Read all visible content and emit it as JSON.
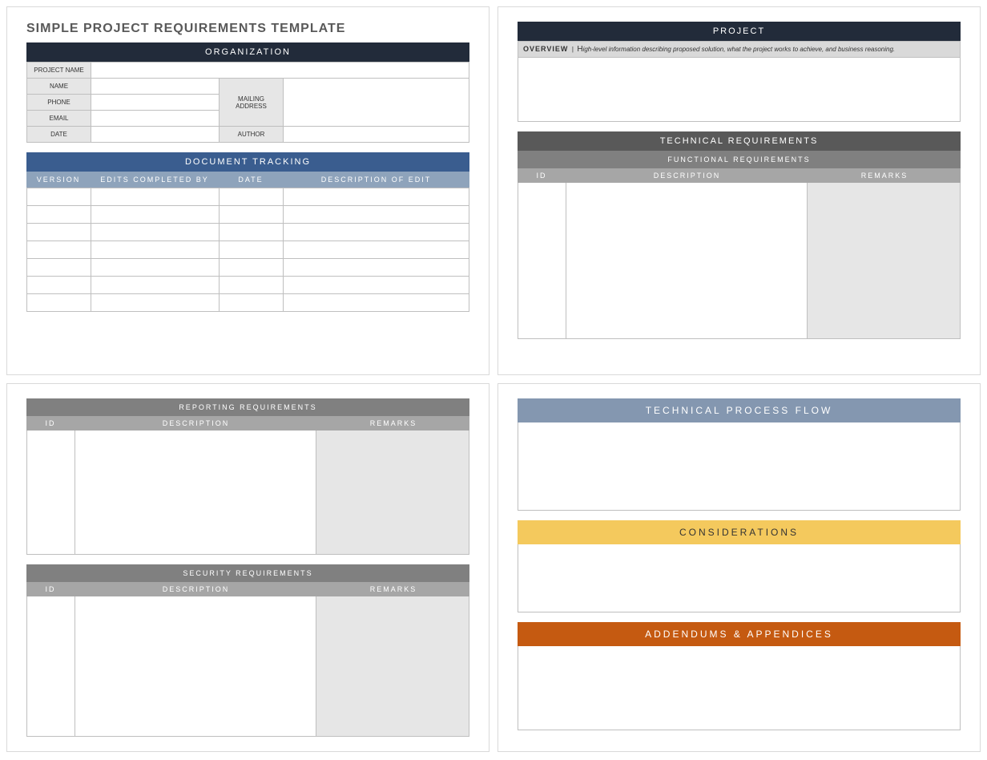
{
  "title": "SIMPLE PROJECT REQUIREMENTS TEMPLATE",
  "organization": {
    "header": "ORGANIZATION",
    "labels": {
      "project_name": "PROJECT NAME",
      "name": "NAME",
      "phone": "PHONE",
      "email": "EMAIL",
      "date": "DATE",
      "mailing_address": "MAILING ADDRESS",
      "author": "AUTHOR"
    },
    "values": {
      "project_name": "",
      "name": "",
      "phone": "",
      "email": "",
      "date": "",
      "mailing_address": "",
      "author": ""
    }
  },
  "tracking": {
    "header": "DOCUMENT TRACKING",
    "columns": [
      "VERSION",
      "EDITS COMPLETED BY",
      "DATE",
      "DESCRIPTION OF EDIT"
    ],
    "rows": [
      [
        "",
        "",
        "",
        ""
      ],
      [
        "",
        "",
        "",
        ""
      ],
      [
        "",
        "",
        "",
        ""
      ],
      [
        "",
        "",
        "",
        ""
      ],
      [
        "",
        "",
        "",
        ""
      ],
      [
        "",
        "",
        "",
        ""
      ],
      [
        "",
        "",
        "",
        ""
      ]
    ]
  },
  "project": {
    "header": "PROJECT",
    "overview_label": "OVERVIEW",
    "overview_divider": "|",
    "overview_hint_lead": "H",
    "overview_hint_rest": "igh-level information describing proposed solution, what the project works to achieve, and business reasoning."
  },
  "tech_req": {
    "header": "TECHNICAL REQUIREMENTS",
    "functional": {
      "header": "FUNCTIONAL REQUIREMENTS",
      "columns": [
        "ID",
        "DESCRIPTION",
        "REMARKS"
      ]
    }
  },
  "reporting": {
    "header": "REPORTING REQUIREMENTS",
    "columns": [
      "ID",
      "DESCRIPTION",
      "REMARKS"
    ]
  },
  "security": {
    "header": "SECURITY REQUIREMENTS",
    "columns": [
      "ID",
      "DESCRIPTION",
      "REMARKS"
    ]
  },
  "process_flow": {
    "header": "TECHNICAL PROCESS FLOW"
  },
  "considerations": {
    "header": "CONSIDERATIONS"
  },
  "addendums": {
    "header": "ADDENDUMS & APPENDICES"
  }
}
